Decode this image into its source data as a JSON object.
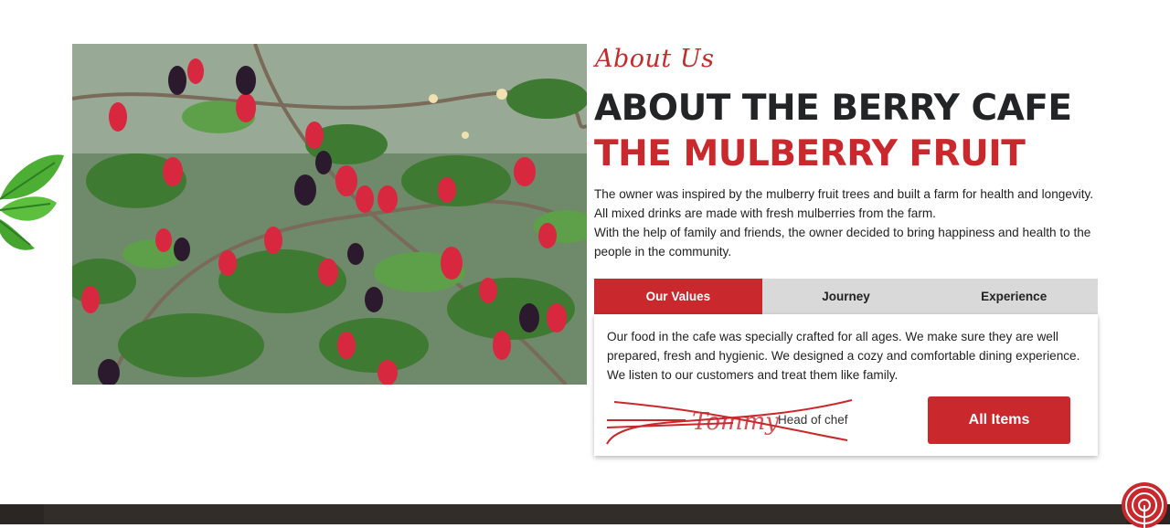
{
  "about": {
    "script_title": "About Us",
    "heading_line1": "ABOUT THE BERRY CAFE",
    "heading_line2": "THE MULBERRY FRUIT",
    "paragraph1": "The owner was inspired by the mulberry fruit trees and built a farm for health and longevity. All mixed drinks are made with fresh mulberries from the farm.",
    "paragraph2": "With the help of family and friends, the owner decided to bring happiness and health to the people in the community."
  },
  "tabs": [
    {
      "label": "Our Values",
      "active": true
    },
    {
      "label": "Journey",
      "active": false
    },
    {
      "label": "Experience",
      "active": false
    }
  ],
  "panel": {
    "text": "Our food in the cafe was specially crafted for all ages. We make sure they are well prepared, fresh and hygienic. We designed a cozy and comfortable dining experience. We listen to our customers and treat them like family.",
    "signature_name": "Tommy",
    "chef_label": "Head of chef",
    "button_label": "All Items"
  },
  "colors": {
    "accent": "#c9282d",
    "heading_dark": "#222426",
    "tab_inactive_bg": "#d9d9d9",
    "footer_bg": "#2b2624"
  },
  "icons": {
    "leaf": "green-leaf-icon",
    "fab": "broadcast-icon"
  },
  "image": {
    "subject": "mulberry-branches-photo"
  }
}
